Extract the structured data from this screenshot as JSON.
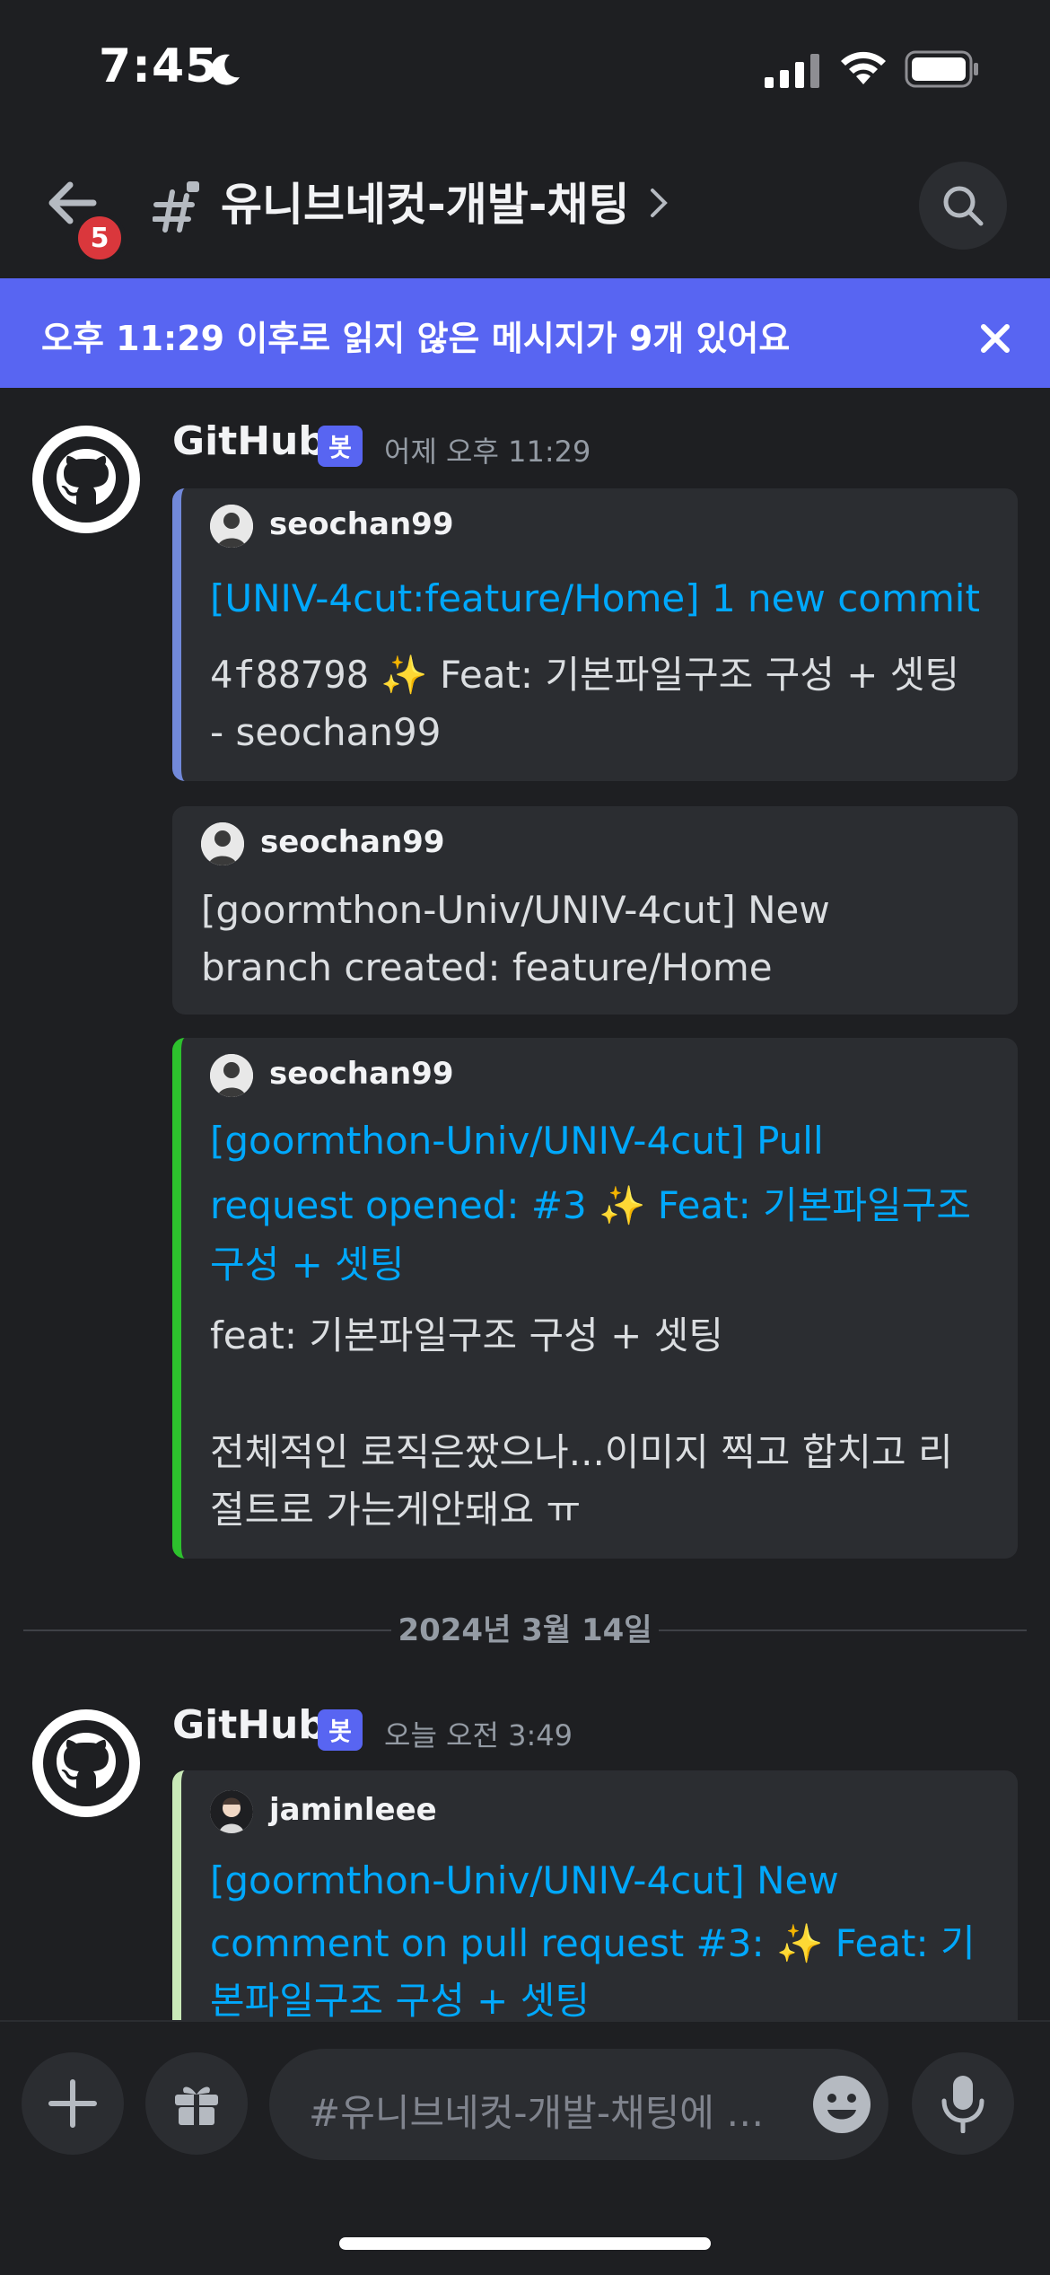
{
  "status_bar": {
    "time": "7:45",
    "icons": [
      "moon-icon",
      "signal-icon",
      "wifi-icon",
      "battery-icon"
    ]
  },
  "header": {
    "unread_badge": "5",
    "channel_name": "유니브네컷-개발-채팅",
    "icons": [
      "back-arrow-icon",
      "hash-lock-icon",
      "chevron-right-icon",
      "search-icon"
    ]
  },
  "banner": {
    "text": "오후 11:29 이후로 읽지 않은 메시지가 9개 있어요",
    "color": "#5865f2"
  },
  "messages": [
    {
      "author": "GitHub",
      "bot_tag": "봇",
      "timestamp": "어제 오후 11:29",
      "embeds": [
        {
          "author": "seochan99",
          "title": "[UNIV-4cut:feature/Home] 1 new commit",
          "commit_hash": "4f88798",
          "commit_text": "✨ Feat: 기본파일구조 구성 + 셋팅",
          "commit_author": "- seochan99",
          "bar_color": "#7289da"
        },
        {
          "author": "seochan99",
          "text_line1": "[goormthon-Univ/UNIV-4cut] New",
          "text_line2": "branch created: feature/Home"
        },
        {
          "author": "seochan99",
          "title_line1": "[goormthon-Univ/UNIV-4cut] Pull",
          "title_line2": "request opened: #3 ✨ Feat: 기본파일구조",
          "title_line3": "구성 + 셋팅",
          "desc_line1": "feat: 기본파일구조 구성 + 셋팅",
          "desc_line2": "전체적인 로직은짰으나...이미지 찍고 합치고 리",
          "desc_line3": "절트로 가는게안돼요 ㅠ",
          "bar_color": "#2dc12d"
        }
      ]
    },
    {
      "author": "GitHub",
      "bot_tag": "봇",
      "timestamp": "오늘 오전 3:49",
      "embeds": [
        {
          "author": "jaminleee",
          "title_line1": "[goormthon-Univ/UNIV-4cut] New",
          "title_line2": "comment on pull request #3: ✨ Feat: 기",
          "title_line3": "본파일구조 구성 + 셋팅",
          "bar_color": "#c9e9b8"
        }
      ]
    }
  ],
  "date_divider": "2024년 3월 14일",
  "input_bar": {
    "placeholder": "#유니브네컷-개발-채팅에 메시지 보내기",
    "icons": [
      "plus-icon",
      "gift-icon",
      "emoji-icon",
      "microphone-icon"
    ]
  }
}
